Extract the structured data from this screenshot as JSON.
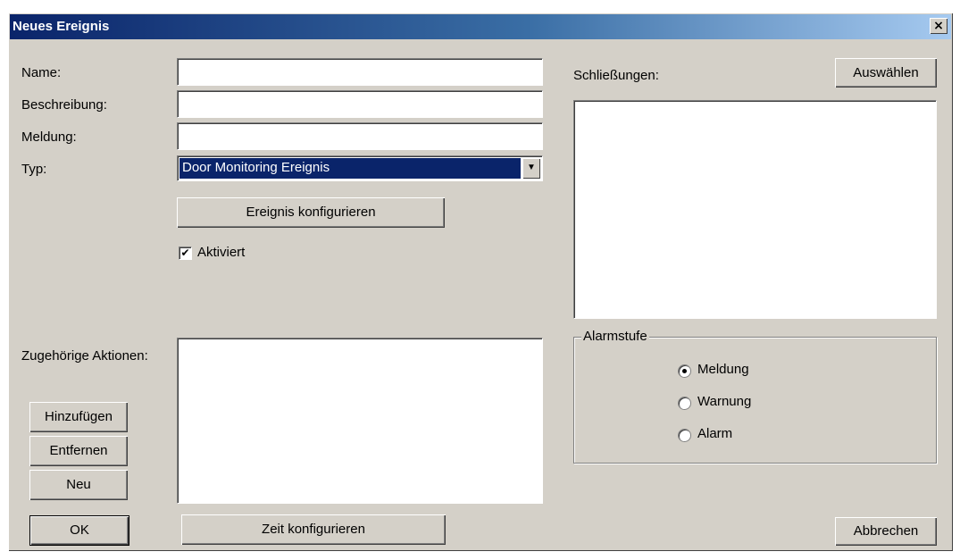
{
  "dialog": {
    "title": "Neues Ereignis",
    "close_glyph": "×"
  },
  "form": {
    "name_label": "Name:",
    "name_value": "",
    "description_label": "Beschreibung:",
    "description_value": "",
    "message_label": "Meldung:",
    "message_value": "",
    "type_label": "Typ:",
    "type_selected": "Door Monitoring Ereignis",
    "configure_event_button": "Ereignis konfigurieren",
    "activated_label": "Aktiviert",
    "activated_checked": true,
    "actions_label": "Zugehörige Aktionen:",
    "add_button": "Hinzufügen",
    "remove_button": "Entfernen",
    "new_button": "Neu",
    "configure_time_button": "Zeit konfigurieren"
  },
  "locks": {
    "label": "Schließungen:",
    "select_button": "Auswählen",
    "items": []
  },
  "alarm": {
    "legend": "Alarmstufe",
    "options": [
      {
        "label": "Meldung",
        "checked": true
      },
      {
        "label": "Warnung",
        "checked": false
      },
      {
        "label": "Alarm",
        "checked": false
      }
    ]
  },
  "footer": {
    "ok_button": "OK",
    "cancel_button": "Abbrechen"
  },
  "colors": {
    "dialog_bg": "#d4d0c8",
    "title_start": "#0a246a",
    "title_end": "#a6caf0",
    "selection": "#0a246a"
  },
  "icons": {
    "close": "close-icon",
    "dropdown": "chevron-down-icon",
    "check": "checkmark-icon"
  }
}
